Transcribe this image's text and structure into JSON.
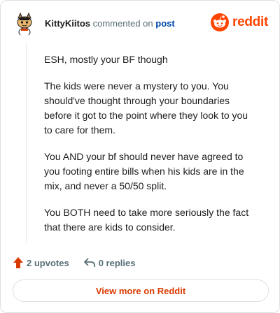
{
  "header": {
    "username": "KittyKiitos",
    "commented_text": "commented on",
    "post_link": "post",
    "brand": "reddit"
  },
  "comment": {
    "paragraphs": [
      "ESH, mostly your BF though",
      "The kids were never a mystery to you. You should've thought through your boundaries before it got to the point where they look to you to care for them.",
      "You AND your bf should never have agreed to you footing entire bills when his kids are in the mix, and never a 50/50 split.",
      "You BOTH need to take more seriously the fact that there are kids to consider."
    ]
  },
  "actions": {
    "upvotes": "2 upvotes",
    "replies": "0 replies"
  },
  "footer": {
    "view_more": "View more on Reddit"
  },
  "colors": {
    "brand": "#ff4500",
    "link": "#0045ac",
    "muted": "#576f76",
    "view_more": "#d93a00"
  },
  "icons": {
    "avatar": "snoo-avatar-icon",
    "logo": "reddit-logo-icon",
    "upvote": "upvote-arrow-icon",
    "reply": "reply-arrow-icon"
  }
}
